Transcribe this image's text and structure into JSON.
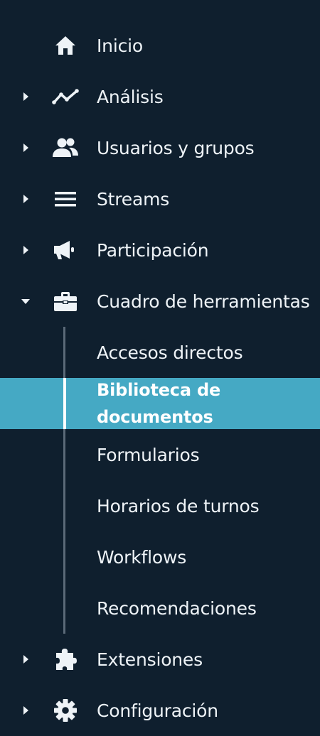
{
  "nav": {
    "items": [
      {
        "label": "Inicio"
      },
      {
        "label": "Análisis"
      },
      {
        "label": "Usuarios y grupos"
      },
      {
        "label": "Streams"
      },
      {
        "label": "Participación"
      },
      {
        "label": "Cuadro de herramientas"
      },
      {
        "label": "Extensiones"
      },
      {
        "label": "Configuración"
      }
    ],
    "toolbox_children": [
      {
        "label": "Accesos directos"
      },
      {
        "label": "Biblioteca de documentos"
      },
      {
        "label": "Formularios"
      },
      {
        "label": "Horarios de turnos"
      },
      {
        "label": "Workflows"
      },
      {
        "label": "Recomendaciones"
      }
    ]
  },
  "colors": {
    "background": "#0f1f2e",
    "active_background": "#45a9c4",
    "text": "#eef3f7"
  },
  "icons": [
    "home-icon",
    "analytics-icon",
    "users-icon",
    "streams-icon",
    "megaphone-icon",
    "toolbox-icon",
    "puzzle-icon",
    "gear-icon"
  ]
}
